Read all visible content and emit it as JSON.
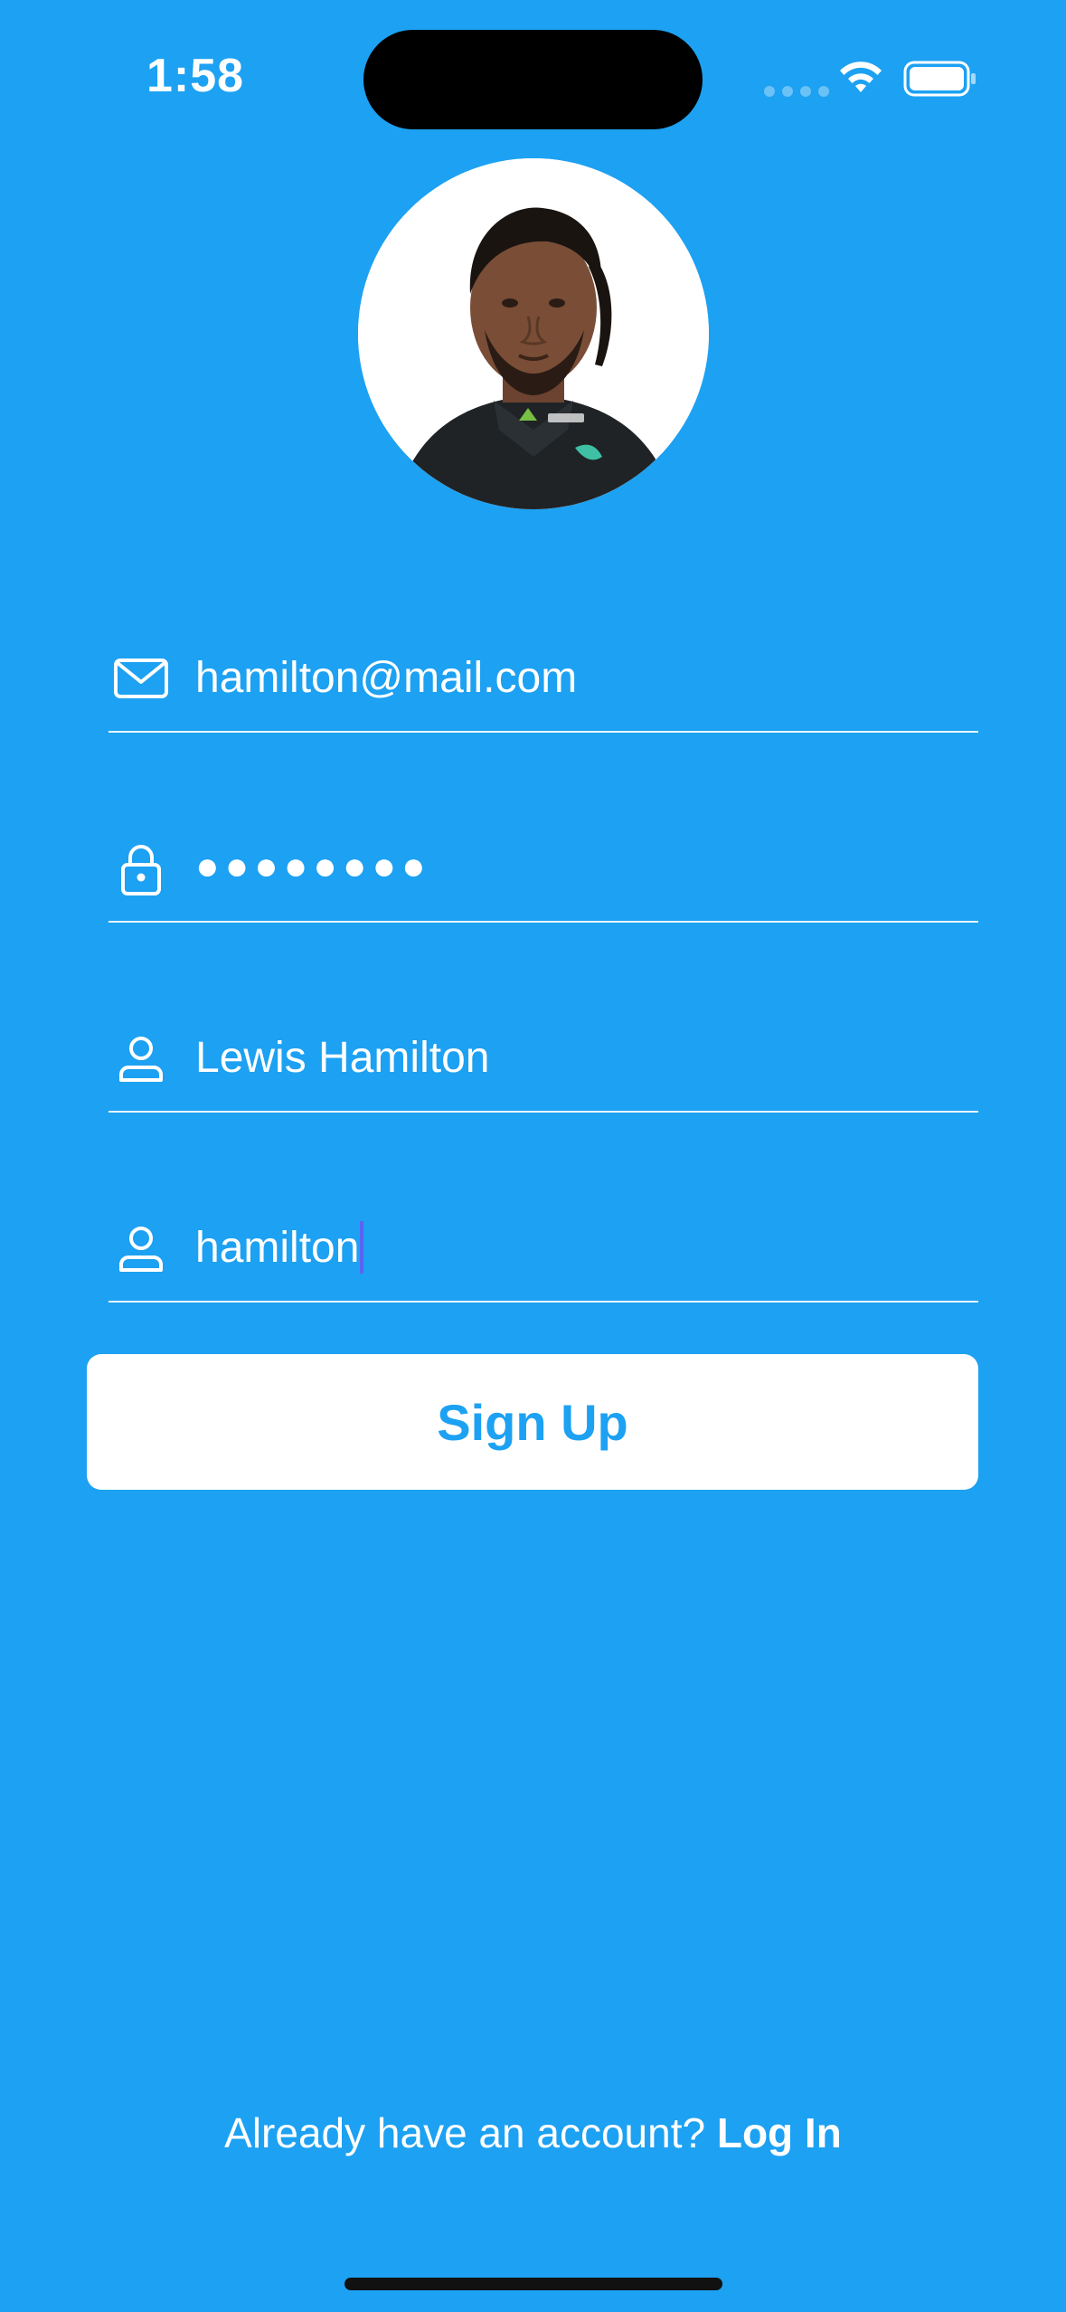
{
  "status_bar": {
    "time": "1:58"
  },
  "colors": {
    "background": "#1DA1F2",
    "button_bg": "#FFFFFF",
    "button_text": "#1DA1F2",
    "caret": "#5865F2"
  },
  "profile": {
    "avatar_icon": "profile-photo"
  },
  "form": {
    "email": {
      "icon": "mail-icon",
      "value": "hamilton@mail.com"
    },
    "password": {
      "icon": "lock-icon",
      "value": "●●●●●●●●"
    },
    "full_name": {
      "icon": "person-icon",
      "value": "Lewis Hamilton"
    },
    "username": {
      "icon": "person-icon",
      "value": "hamilton"
    }
  },
  "signup_button": {
    "label": "Sign Up"
  },
  "footer": {
    "prompt": "Already have an account?",
    "login_label": "Log In"
  }
}
